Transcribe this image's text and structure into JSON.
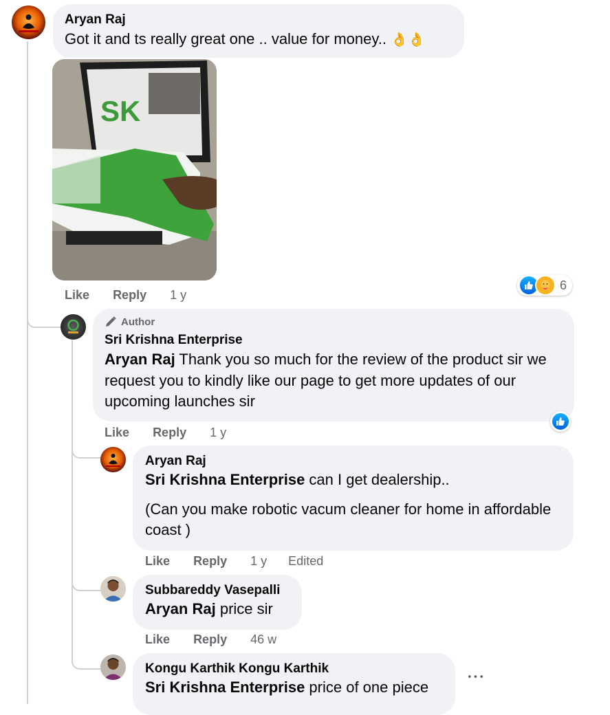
{
  "comments": {
    "c1": {
      "author": "Aryan Raj",
      "text": "Got it and ts really great one .. value for money..",
      "emoji": "👌👌",
      "actions": {
        "like": "Like",
        "reply": "Reply",
        "time": "1 y"
      },
      "reactions": {
        "count": "6",
        "icons": [
          "like-icon",
          "care-icon"
        ]
      }
    },
    "c2": {
      "badge": "Author",
      "author": "Sri Krishna Enterprise",
      "mention": "Aryan Raj",
      "text": " Thank you so much for the review of the product sir we request you to kindly like our page to get more updates of our upcoming launches sir",
      "actions": {
        "like": "Like",
        "reply": "Reply",
        "time": "1 y"
      },
      "reactions": {
        "icons": [
          "like-icon"
        ]
      }
    },
    "c3": {
      "author": "Aryan Raj",
      "mention": "Sri Krishna Enterprise",
      "text": " can I get dealership..",
      "text2": "(Can you make robotic vacum cleaner for home in affordable coast )",
      "actions": {
        "like": "Like",
        "reply": "Reply",
        "time": "1 y",
        "edited": "Edited"
      }
    },
    "c4": {
      "author": "Subbareddy Vasepalli",
      "mention": "Aryan Raj",
      "text": " price sir",
      "actions": {
        "like": "Like",
        "reply": "Reply",
        "time": "46 w"
      }
    },
    "c5": {
      "author": "Kongu Karthik Kongu Karthik",
      "mention": "Sri Krishna Enterprise",
      "text": " price of one piece",
      "more": "•••"
    }
  },
  "colors": {
    "bubble": "#f0f2f5",
    "meta": "#65676b",
    "like_blue": "#0866ff",
    "thread_line": "#ced0d4"
  }
}
